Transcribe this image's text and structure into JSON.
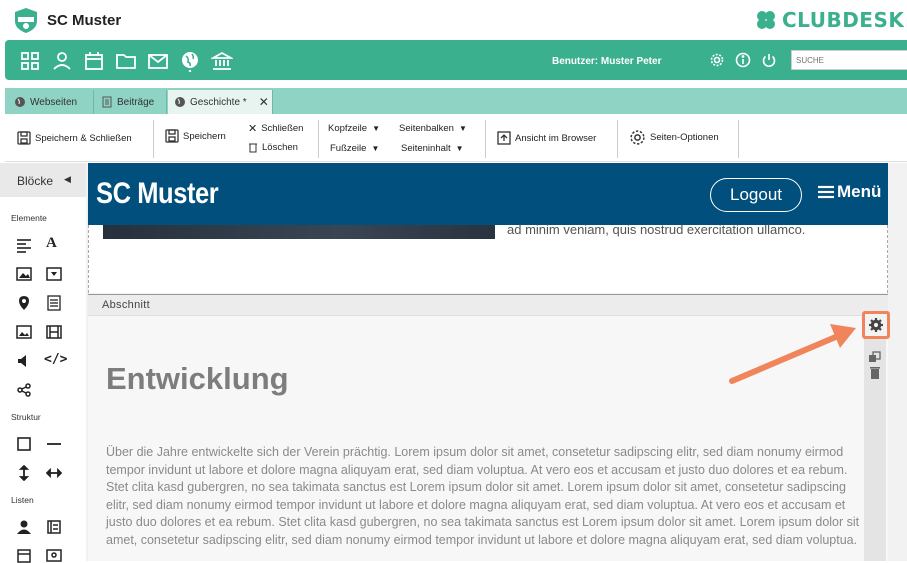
{
  "app": {
    "title": "SC Muster",
    "brand": "CLUBDESK"
  },
  "nav": {
    "icons": [
      "dashboard-icon",
      "person-icon",
      "calendar-icon",
      "folder-icon",
      "mail-icon",
      "globe-icon",
      "bank-icon"
    ],
    "user_label": "Benutzer: Muster Peter",
    "search_placeholder": "SUCHE"
  },
  "tabs": [
    {
      "label": "Webseiten",
      "icon": "globe-icon"
    },
    {
      "label": "Beiträge",
      "icon": "document-icon"
    },
    {
      "label": "Geschichte *",
      "icon": "globe-icon",
      "active": true
    }
  ],
  "toolbar": {
    "save_close": "Speichern & Schließen",
    "save": "Speichern",
    "close": "Schließen",
    "delete": "Löschen",
    "header": "Kopfzeile",
    "footer": "Fußzeile",
    "sidebar": "Seitenbalken",
    "page_content": "Seiteninhalt",
    "view_browser": "Ansicht im Browser",
    "page_options": "Seiten-Optionen"
  },
  "sidebar": {
    "title": "Blöcke",
    "categories": [
      "Elemente",
      "Struktur",
      "Listen"
    ]
  },
  "site": {
    "title": "SC Muster",
    "logout": "Logout",
    "menu": "Menü",
    "prev_text": "ad minim veniam, quis nostrud exercitation ullamco."
  },
  "section": {
    "label": "Abschnitt",
    "heading": "Entwicklung",
    "paragraph": "Über die Jahre entwickelte sich der Verein prächtig. Lorem ipsum dolor sit amet, consetetur sadipscing elitr, sed diam nonumy eirmod tempor invidunt ut labore et dolore magna aliquyam erat, sed diam voluptua. At vero eos et accusam et justo duo dolores et ea rebum. Stet clita kasd gubergren, no sea takimata sanctus est Lorem ipsum dolor sit amet. Lorem ipsum dolor sit amet, consetetur sadipscing elitr, sed diam nonumy eirmod tempor invidunt ut labore et dolore magna aliquyam erat, sed diam voluptua. At vero eos et accusam et justo duo dolores et ea rebum. Stet clita kasd gubergren, no sea takimata sanctus est Lorem ipsum dolor sit amet. Lorem ipsum dolor sit amet, consetetur sadipscing elitr, sed diam nonumy eirmod tempor invidunt ut labore et dolore magna aliquyam erat, sed diam voluptua."
  },
  "colors": {
    "accent": "#3bb08f",
    "tab_bar": "#8ed3c3",
    "site_header": "#004f7c",
    "highlight": "#f0855b"
  }
}
